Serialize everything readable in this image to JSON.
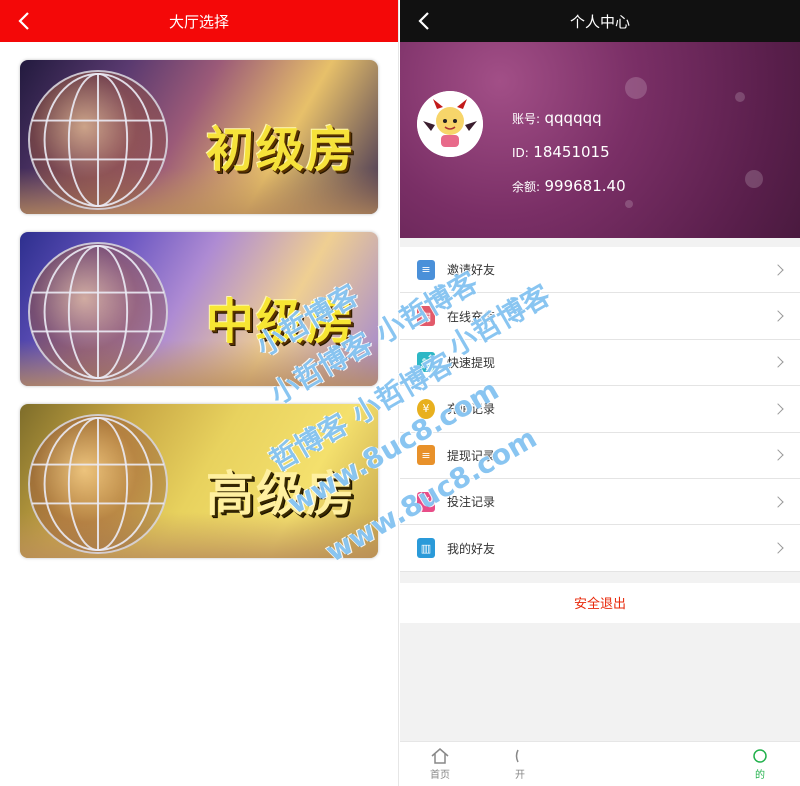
{
  "left": {
    "header_title": "大厅选择",
    "rooms": [
      {
        "label": "初级房"
      },
      {
        "label": "中级房"
      },
      {
        "label": "高级房"
      }
    ]
  },
  "right": {
    "header_title": "个人中心",
    "profile": {
      "account_label": "账号:",
      "account_value": "qqqqqq",
      "id_label": "ID:",
      "id_value": "18451015",
      "balance_label": "余额:",
      "balance_value": "999681.40"
    },
    "menu": [
      {
        "label": "邀请好友",
        "icon": "invite-icon",
        "color": "#4a90d9"
      },
      {
        "label": "在线充值",
        "icon": "recharge-icon",
        "color": "#e25a6a"
      },
      {
        "label": "快速提现",
        "icon": "withdraw-icon",
        "color": "#2db7c5"
      },
      {
        "label": "充值记录",
        "icon": "yuan-coin-icon",
        "color": "#e8b01e"
      },
      {
        "label": "提现记录",
        "icon": "document-icon",
        "color": "#e8912a"
      },
      {
        "label": "投注记录",
        "icon": "bet-icon",
        "color": "#e84d88"
      },
      {
        "label": "我的好友",
        "icon": "book-icon",
        "color": "#2a9ad9"
      }
    ],
    "logout_label": "安全退出",
    "tabs": [
      {
        "label": "首页",
        "icon": "home-icon"
      },
      {
        "label": "开",
        "icon": "list-icon"
      },
      {
        "label": "",
        "icon": "blank-icon"
      },
      {
        "label": "",
        "icon": "blank-icon"
      },
      {
        "label": "的",
        "icon": "user-icon"
      }
    ]
  },
  "watermark": {
    "lines": [
      "小哲博客",
      "小哲博客 小哲博客",
      "哲博客 小哲博客",
      "www.8uc8.com",
      "www.8uc8.com",
      "小哲博客"
    ]
  },
  "colors": {
    "left_header": "#f40808",
    "right_header": "#111111",
    "logout_text": "#e8290b",
    "active_tab": "#22b14c"
  }
}
